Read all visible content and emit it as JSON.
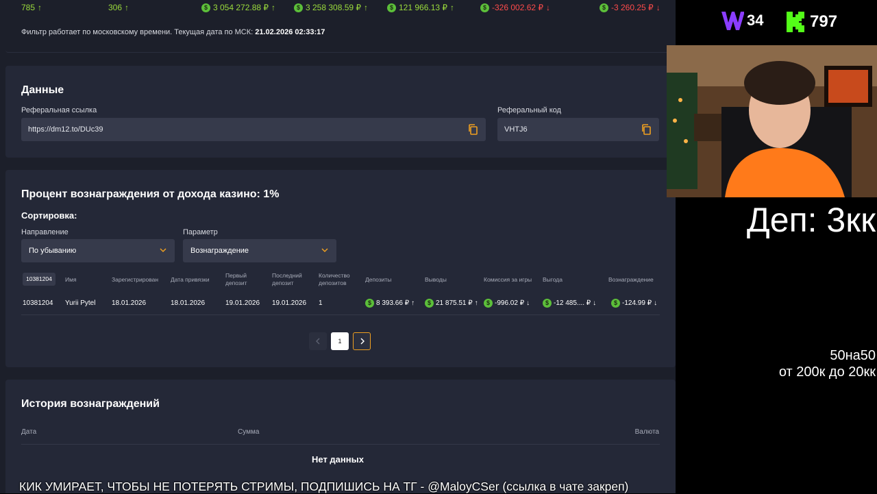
{
  "stats": [
    {
      "value": "785",
      "coin": false,
      "trend": "up",
      "color": "green"
    },
    {
      "value": "306",
      "coin": false,
      "trend": "up",
      "color": "green"
    },
    {
      "value": "3 054 272.88 ₽",
      "coin": true,
      "trend": "up",
      "color": "green"
    },
    {
      "value": "3 258 308.59 ₽",
      "coin": true,
      "trend": "up",
      "color": "green"
    },
    {
      "value": "121 966.13 ₽",
      "coin": true,
      "trend": "up",
      "color": "green"
    },
    {
      "value": "-326 002.62 ₽",
      "coin": true,
      "trend": "down",
      "color": "red"
    },
    {
      "value": "-3 260.25 ₽",
      "coin": true,
      "trend": "down",
      "color": "red"
    }
  ],
  "filter_note": {
    "text": "Фильтр работает по московскому времени. Текущая дата по МСК:",
    "datetime": "21.02.2026 02:33:17"
  },
  "data_section": {
    "title": "Данные",
    "ref_link_label": "Реферальная ссылка",
    "ref_link_value": "https://dm12.to/DUc39",
    "ref_code_label": "Реферальный код",
    "ref_code_value": "VHTJ6"
  },
  "reward_section": {
    "title": "Процент вознаграждения от дохода казино: 1%",
    "sort_label": "Сортировка:",
    "direction_label": "Направление",
    "direction_value": "По убыванию",
    "param_label": "Параметр",
    "param_value": "Вознаграждение",
    "columns": [
      "10381204",
      "Имя",
      "Зарегистрирован",
      "Дата привязки",
      "Первый депозит",
      "Последний депозит",
      "Количество депозитов",
      "Депозиты",
      "Выводы",
      "Комиссия за игры",
      "Выгода",
      "Вознаграждение"
    ],
    "row": {
      "id": "10381204",
      "name": "Yurii Pytel",
      "registered": "18.01.2026",
      "bound": "18.01.2026",
      "first_deposit": "19.01.2026",
      "last_deposit": "19.01.2026",
      "deposit_count": "1",
      "deposits": "8 393.66 ₽",
      "withdrawals": "21 875.51 ₽",
      "commission": "-996.02 ₽",
      "profit": "-12 485.... ₽",
      "reward": "-124.99 ₽"
    },
    "pagination": {
      "current": "1",
      "prev_icon": "chevron-left-icon",
      "next_icon": "chevron-right-icon"
    }
  },
  "history_section": {
    "title": "История вознаграждений",
    "col_date": "Дата",
    "col_amount": "Сумма",
    "col_currency": "Валюта",
    "empty": "Нет данных"
  },
  "stream_overlay": {
    "w_count": "34",
    "k_count": "797",
    "dep_text": "Деп: 3кк",
    "line1": "50на50",
    "line2": "от 200к до 20кк",
    "ticker": "КИК УМИРАЕТ, ЧТОБЫ НЕ ПОТЕРЯТЬ СТРИМЫ, ПОДПИШИСЬ НА ТГ - @MaloyCSer (ссылка в чате закреп)"
  },
  "colors": {
    "accent_green": "#9bdc3c",
    "negative_red": "#ff4b4b",
    "panel": "#242837",
    "kick_green": "#53fc18",
    "purple": "#8b3dff"
  }
}
